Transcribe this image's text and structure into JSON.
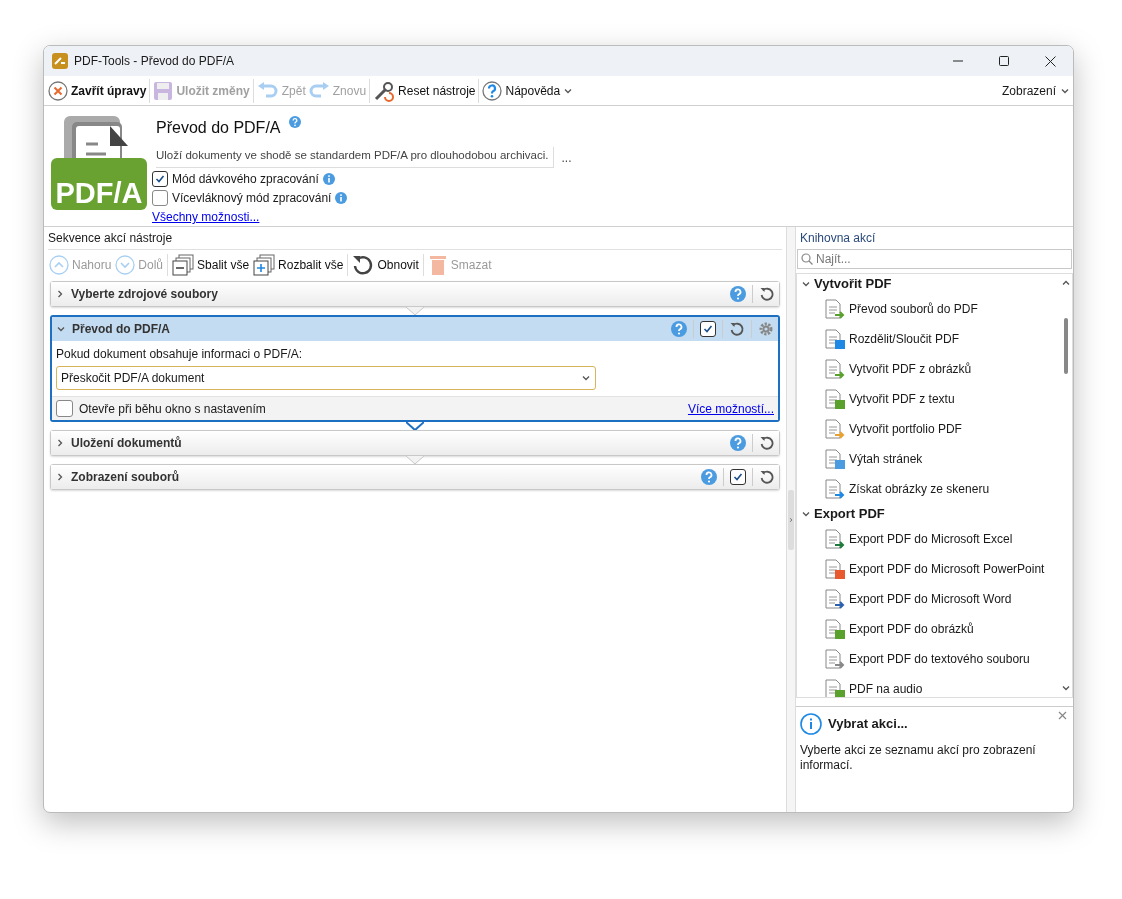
{
  "window": {
    "title": "PDF-Tools - Převod do PDF/A"
  },
  "toolbar": {
    "items": [
      {
        "label": "Zavřít úpravy",
        "disabled": false,
        "kind": "close"
      },
      {
        "label": "Uložit změny",
        "disabled": true,
        "kind": "save"
      },
      {
        "label": "Zpět",
        "disabled": true,
        "kind": "undo"
      },
      {
        "label": "Znovu",
        "disabled": true,
        "kind": "redo"
      },
      {
        "label": "Reset nástroje",
        "disabled": false,
        "kind": "reset"
      },
      {
        "label": "Nápověda",
        "disabled": false,
        "kind": "help"
      }
    ],
    "view_menu": "Zobrazení"
  },
  "header": {
    "title": "Převod do PDF/A",
    "description": "Uloží dokumenty ve shodě se standardem PDF/A pro dlouhodobou archivaci.",
    "more": "...",
    "logo_text": "PDF/A",
    "options": [
      {
        "label": "Mód dávkového zpracování",
        "checked": true
      },
      {
        "label": "Vícevláknový mód zpracování",
        "checked": false
      }
    ],
    "all_options": "Všechny možnosti..."
  },
  "sequence": {
    "title": "Sekvence akcí nástroje",
    "toolbar": [
      {
        "label": "Nahoru",
        "disabled": true,
        "kind": "up"
      },
      {
        "label": "Dolů",
        "disabled": true,
        "kind": "down"
      },
      {
        "label": "Sbalit vše",
        "disabled": false,
        "kind": "collapse"
      },
      {
        "label": "Rozbalit vše",
        "disabled": false,
        "kind": "expand"
      },
      {
        "label": "Obnovit",
        "disabled": false,
        "kind": "refresh"
      },
      {
        "label": "Smazat",
        "disabled": true,
        "kind": "delete"
      }
    ],
    "steps": [
      {
        "title": "Vyberte zdrojové soubory",
        "expanded": false,
        "selected": false
      },
      {
        "title": "Převod do PDF/A",
        "expanded": true,
        "selected": true,
        "enabled": {
          "checked": true
        },
        "settings": true,
        "field_label": "Pokud dokument obsahuje informaci o PDF/A:",
        "dropdown_value": "Přeskočit PDF/A dokument",
        "open_settings": {
          "label": "Otevře při běhu okno s nastavením",
          "checked": false
        },
        "more_link": "Více možností..."
      },
      {
        "title": "Uložení dokumentů",
        "expanded": false,
        "selected": false
      },
      {
        "title": "Zobrazení souborů",
        "expanded": false,
        "selected": false,
        "enabled": {
          "checked": true
        }
      }
    ]
  },
  "library": {
    "title": "Knihovna akcí",
    "search": {
      "placeholder": "Najít..."
    },
    "groups": [
      {
        "title": "Vytvořit PDF",
        "expanded": true,
        "items": [
          {
            "label": "Převod souborů do PDF"
          },
          {
            "label": "Rozdělit/Sloučit PDF"
          },
          {
            "label": "Vytvořit PDF z obrázků"
          },
          {
            "label": "Vytvořit PDF z textu"
          },
          {
            "label": "Vytvořit portfolio PDF"
          },
          {
            "label": "Výtah stránek"
          },
          {
            "label": "Získat obrázky ze skeneru"
          }
        ]
      },
      {
        "title": "Export PDF",
        "expanded": true,
        "items": [
          {
            "label": "Export PDF do Microsoft Excel"
          },
          {
            "label": "Export PDF do Microsoft PowerPoint"
          },
          {
            "label": "Export PDF do Microsoft Word"
          },
          {
            "label": "Export PDF do obrázků"
          },
          {
            "label": "Export PDF do textového souboru"
          },
          {
            "label": "PDF na audio"
          }
        ]
      }
    ]
  },
  "info": {
    "title": "Vybrat akci...",
    "text": "Vyberte akci ze seznamu akcí pro zobrazení informací."
  }
}
